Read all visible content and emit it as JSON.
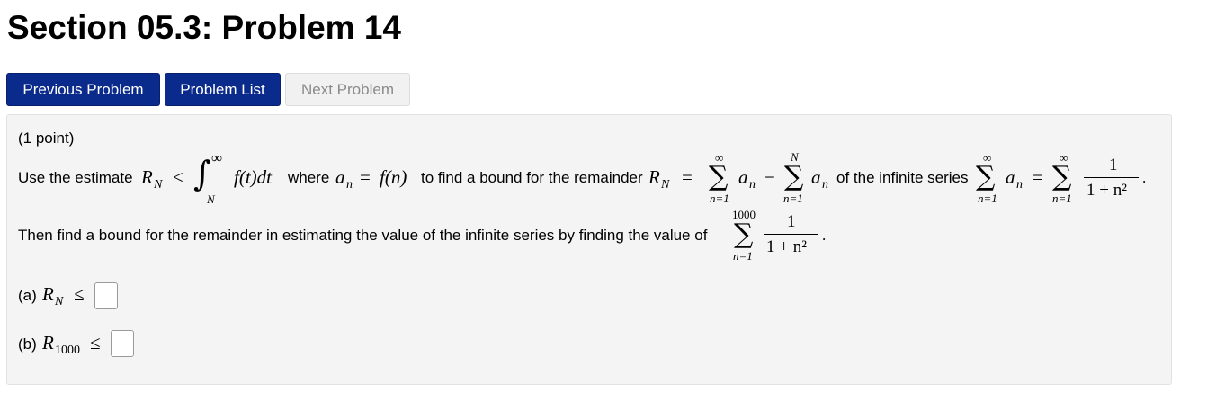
{
  "page": {
    "title": "Section 05.3: Problem 14"
  },
  "nav": {
    "previous": "Previous Problem",
    "list": "Problem List",
    "next": "Next Problem"
  },
  "problem": {
    "points": "(1 point)",
    "line1": {
      "use_estimate": "Use the estimate",
      "R_N": "R",
      "sub_N": "N",
      "le": "≤",
      "integral": "∫",
      "int_upper": "∞",
      "int_lower": "N",
      "integrand": "f(t)dt",
      "where": "where",
      "a_n": "a",
      "sub_n": "n",
      "eq": "=",
      "f_n": "f(n)",
      "to_find": "to find a bound for the remainder",
      "sigma": "∑",
      "inf": "∞",
      "n_eq_1": "n=1",
      "minus": "−",
      "upper_N": "N",
      "of_series": "of the infinite series",
      "one": "1",
      "den": "1 + n²",
      "period": "."
    },
    "line2": {
      "text": "Then find a bound for the remainder in estimating the value of the infinite series by finding the value of",
      "upper": "1000"
    },
    "answers": {
      "a_label": "(a)",
      "b_label": "(b)",
      "b_sub": "1000"
    }
  }
}
